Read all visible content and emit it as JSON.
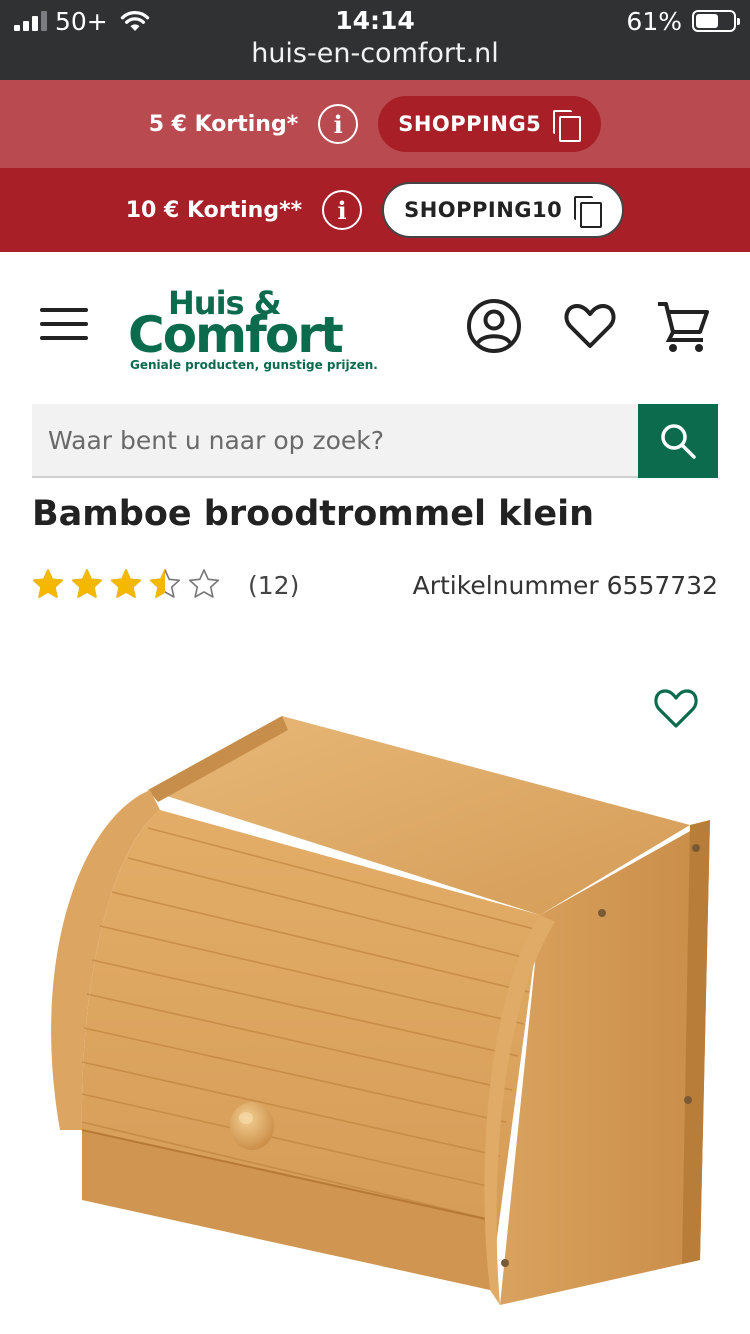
{
  "status_bar": {
    "carrier": "50+",
    "time": "14:14",
    "battery_percent": "61%",
    "battery_level": 0.61,
    "url": "huis-en-comfort.nl"
  },
  "promos": [
    {
      "text": "5 € Korting*",
      "code": "SHOPPING5",
      "background": "#b94a4f"
    },
    {
      "text": "10 € Korting**",
      "code": "SHOPPING10",
      "background": "#a81f28"
    }
  ],
  "brand": {
    "name_top": "Huis &",
    "name_main": "Comfort",
    "tagline": "Geniale producten, gunstige prijzen.",
    "color": "#0b6b4c"
  },
  "header_icons": [
    "menu-icon",
    "account-icon",
    "heart-icon",
    "cart-icon"
  ],
  "search": {
    "placeholder": "Waar bent u naar op zoek?",
    "button_icon": "search-icon"
  },
  "product": {
    "title": "Bamboe broodtrommel klein",
    "rating": 3.5,
    "rating_max": 5,
    "review_count": "(12)",
    "article_number": "Artikelnummer 6557732",
    "favorite_icon": "heart-icon",
    "star_color": "#f5b800"
  }
}
